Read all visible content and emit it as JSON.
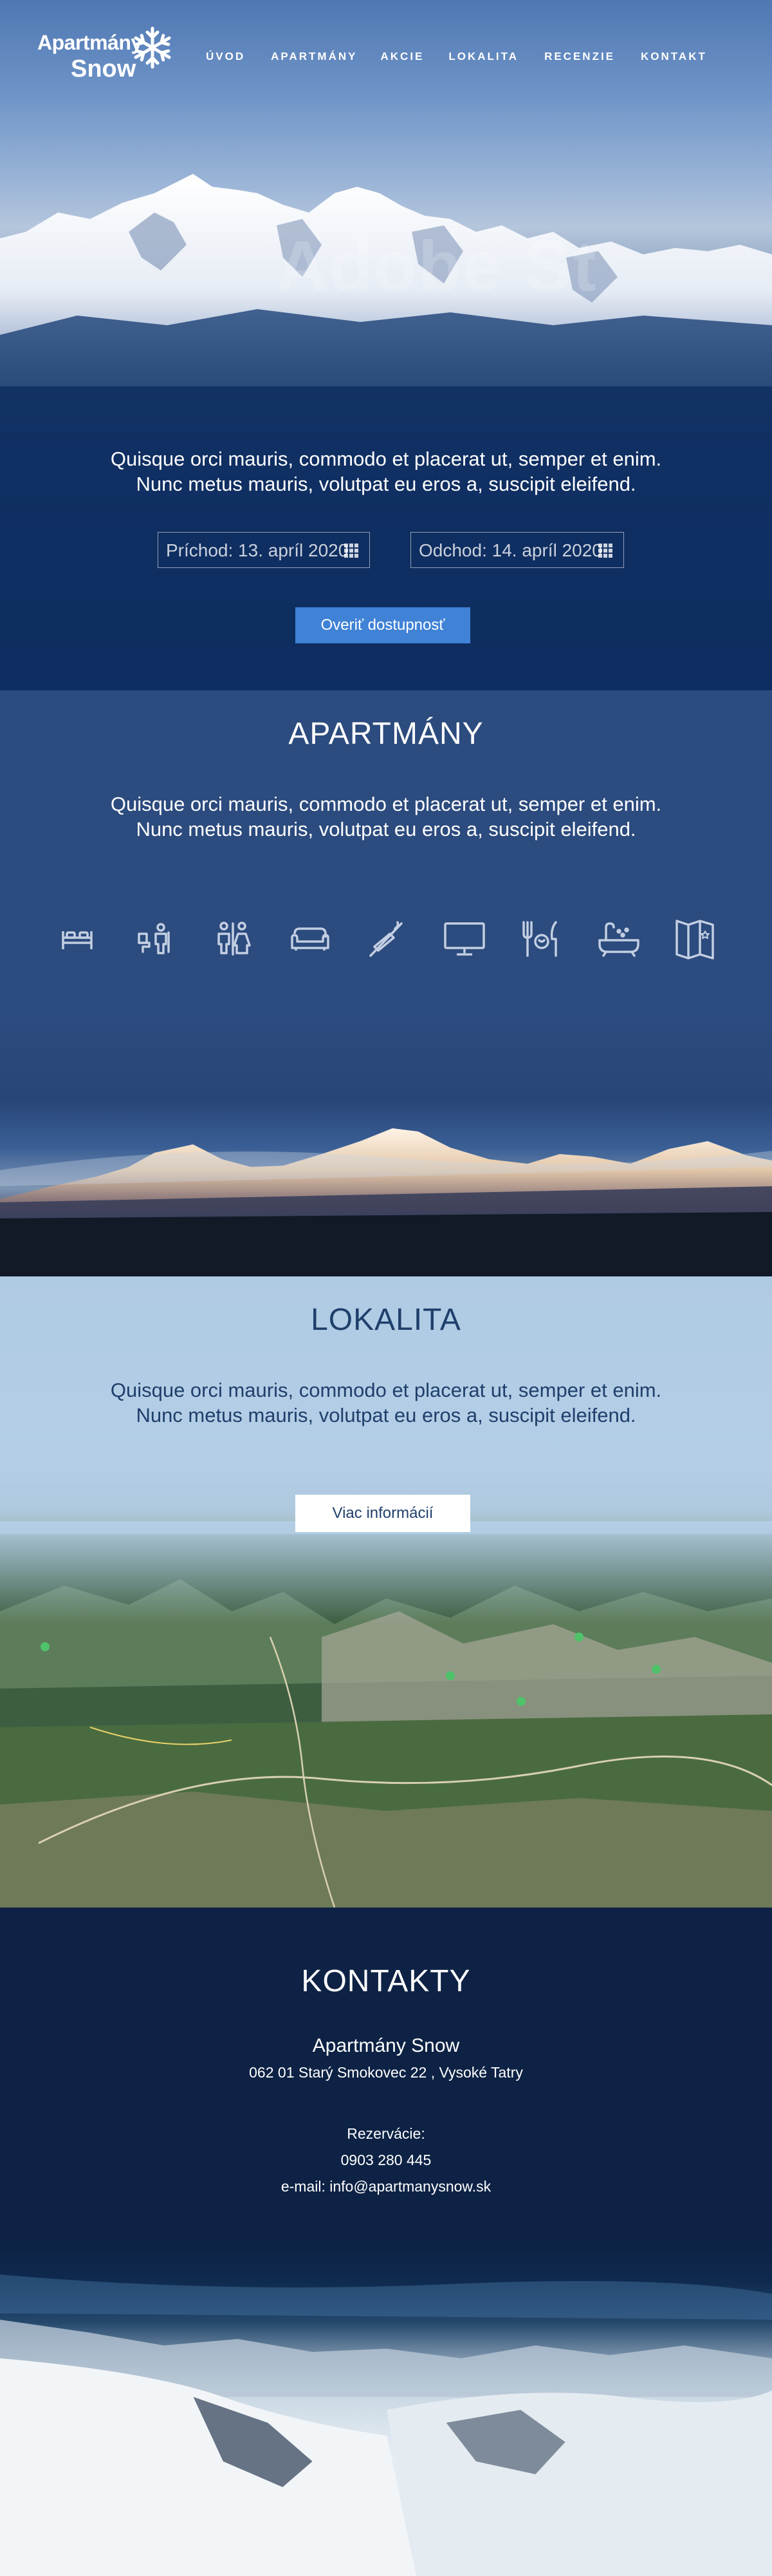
{
  "brand": {
    "line1": "Apartmány",
    "line2": "Snow"
  },
  "nav": {
    "items": [
      {
        "label": "ÚVOD"
      },
      {
        "label": "APARTMÁNY"
      },
      {
        "label": "AKCIE"
      },
      {
        "label": "LOKALITA"
      },
      {
        "label": "RECENZIE"
      },
      {
        "label": "KONTAKT"
      }
    ]
  },
  "hero": {
    "watermark": "Adobe St",
    "lead_line1": "Quisque orci mauris, commodo et placerat ut, semper et enim.",
    "lead_line2": "Nunc metus mauris, volutpat eu eros a, suscipit eleifend.",
    "arrival": "Príchod: 13. apríl 2020",
    "departure": "Odchod: 14. apríl 2020",
    "check_button": "Overiť dostupnosť"
  },
  "apartmany": {
    "title": "APARTMÁNY",
    "lead_line1": "Quisque orci mauris, commodo et placerat ut, semper et enim.",
    "lead_line2": "Nunc metus mauris, volutpat eu eros a, suscipit eleifend.",
    "amenities": [
      "bed-icon",
      "shower-toilet-icon",
      "wc-icon",
      "sofa-icon",
      "no-smoking-icon",
      "tv-icon",
      "dining-icon",
      "bathtub-icon",
      "map-icon"
    ]
  },
  "lokalita": {
    "title": "LOKALITA",
    "lead_line1": "Quisque orci mauris, commodo et placerat ut, semper et enim.",
    "lead_line2": "Nunc metus mauris, volutpat eu eros a, suscipit eleifend.",
    "more_button": "Viac informácií"
  },
  "kontakty": {
    "title": "KONTAKTY",
    "name": "Apartmány Snow",
    "address": "062 01 Starý Smokovec 22 , Vysoké Tatry",
    "reservations_label": "Rezervácie:",
    "phone": "0903 280 445",
    "email": "e-mail: info@apartmanysnow.sk"
  },
  "colors": {
    "accent_button": "#3f82d6",
    "hero_navy": "#0d2b5d",
    "apartmany_blue": "#2c4b7e",
    "lokalita_sky": "#b3cee6",
    "kontakty_navy": "#0d2244",
    "dark_text": "#1f3f6c"
  }
}
